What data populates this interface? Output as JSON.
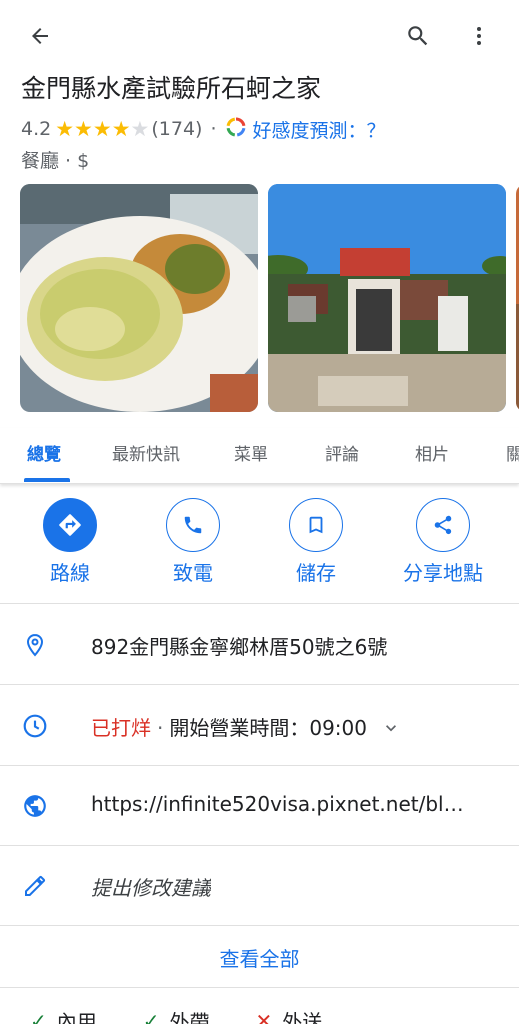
{
  "header": {
    "icons": [
      "arrow-back-icon",
      "search-icon",
      "more-vert-icon"
    ]
  },
  "place": {
    "title": "金門縣水產試驗所石蚵之家",
    "rating": "4.2",
    "stars": 4.2,
    "review_count": "(174)",
    "predict_label": "好感度預測：？",
    "category": "餐廳 · $"
  },
  "tabs": [
    {
      "label": "總覽"
    },
    {
      "label": "最新快訊"
    },
    {
      "label": "菜單"
    },
    {
      "label": "評論"
    },
    {
      "label": "相片"
    },
    {
      "label": "關"
    }
  ],
  "actions": [
    {
      "label": "路線",
      "icon": "directions-icon"
    },
    {
      "label": "致電",
      "icon": "phone-icon"
    },
    {
      "label": "儲存",
      "icon": "bookmark-icon"
    },
    {
      "label": "分享地點",
      "icon": "share-icon"
    }
  ],
  "info": {
    "address": "892金門縣金寧鄉林厝50號之6號",
    "hours_status": "已打烊",
    "hours_detail": "開始營業時間：09:00",
    "website": "https://infinite520visa.pixnet.net/bl…",
    "suggest_edit": "提出修改建議"
  },
  "see_all": "查看全部",
  "services": [
    {
      "label": "內用",
      "available": true
    },
    {
      "label": "外帶",
      "available": true
    },
    {
      "label": "外送",
      "available": false
    }
  ],
  "colors": {
    "accent": "#1a73e8",
    "star": "#fbbc04",
    "closed": "#d93025"
  }
}
